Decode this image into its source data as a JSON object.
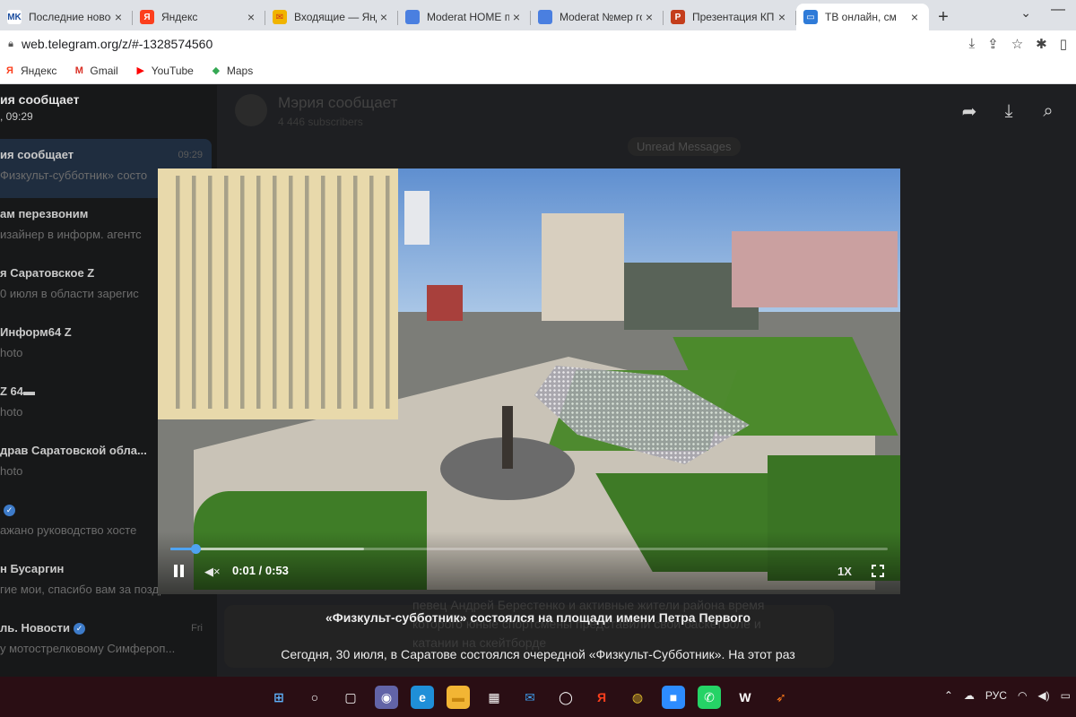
{
  "browser": {
    "tabs": [
      {
        "label": "Последние новос",
        "icon": "MK",
        "color": "#ffffff",
        "fg": "#1d4fa0",
        "active": false
      },
      {
        "label": "Яндекс",
        "icon": "Я",
        "color": "#fc3f1d",
        "fg": "#ffffff",
        "active": false
      },
      {
        "label": "Входящие — Янд",
        "icon": "✉",
        "color": "#f0b400",
        "fg": "#d12e1c",
        "active": false
      },
      {
        "label": "Moderat HOME пр",
        "icon": "",
        "color": "#4a7fe0",
        "fg": "#ffffff",
        "active": false
      },
      {
        "label": "Moderat №мер го",
        "icon": "",
        "color": "#4a7fe0",
        "fg": "#ffffff",
        "active": false
      },
      {
        "label": "Презентация КП.р",
        "icon": "P",
        "color": "#c43e1c",
        "fg": "#ffffff",
        "active": false
      },
      {
        "label": "ТВ онлайн, см",
        "icon": "▭",
        "color": "#2f7bd8",
        "fg": "#ffffff",
        "active": true
      }
    ],
    "new_tab": "+",
    "url": "web.telegram.org/z/#-1328574560",
    "bookmarks": [
      {
        "label": "Яндекс",
        "icon": "Я",
        "color": "#fc3f1d"
      },
      {
        "label": "Gmail",
        "icon": "M",
        "color": "#d93025"
      },
      {
        "label": "YouTube",
        "icon": "▶",
        "color": "#ff0000"
      },
      {
        "label": "Maps",
        "icon": "◆",
        "color": "#34a853"
      }
    ]
  },
  "telegram": {
    "sidebar_header": {
      "title": "ия сообщает",
      "subtitle": ", 09:29"
    },
    "chats": [
      {
        "name": "ия сообщает",
        "preview": "Физкульт-субботник» состо",
        "time": "09:29",
        "selected": true,
        "verified": false
      },
      {
        "name": "ам перезвоним",
        "preview": "изайнер в информ. агентс",
        "time": "",
        "selected": false,
        "verified": false
      },
      {
        "name": "я Саратовское Z",
        "preview": "0 июля в области зарегис",
        "time": "",
        "selected": false,
        "verified": false
      },
      {
        "name": "Информ64 Z",
        "preview": "hoto",
        "time": "",
        "selected": false,
        "verified": false
      },
      {
        "name": "Z 64▬",
        "preview": "hoto",
        "time": "",
        "selected": false,
        "verified": false
      },
      {
        "name": "драв Саратовской обла...",
        "preview": "hoto",
        "time": "",
        "selected": false,
        "verified": false
      },
      {
        "name": "",
        "preview": "ажано руководство хосте",
        "time": "",
        "selected": false,
        "verified": true
      },
      {
        "name": "н Бусаргин",
        "preview": "гие мои, спасибо вам за поздр...",
        "time": "",
        "selected": false,
        "verified": false
      },
      {
        "name": "ль. Новости",
        "preview": "у мотострелковому Симфероп...",
        "time": "Fri",
        "selected": false,
        "verified": true
      }
    ],
    "channel_title": "Мэрия сообщает",
    "channel_subscribers": "4 446 subscribers",
    "unread_label": "Unread Messages",
    "message_text": "певец Андрей Берестенко и активные жители района время которого юные спортсмены представили свои баскетболе и катании на скейтборде"
  },
  "player": {
    "progress_fraction": 0.035,
    "buffered_fraction": 0.27,
    "time": "0:01 / 0:53",
    "speed": "1X",
    "caption_title": "«Физкульт-субботник» состоялся на площади имени Петра Первого",
    "caption_text": "Сегодня, 30 июля, в Саратове состоялся очередной «Физкульт-Субботник». На этот раз"
  },
  "taskbar": {
    "icons": [
      {
        "name": "windows-start-icon",
        "glyph": "⊞",
        "color": "transparent",
        "fg": "#5fb4ff"
      },
      {
        "name": "search-icon",
        "glyph": "○",
        "color": "transparent",
        "fg": "#ffffff"
      },
      {
        "name": "task-view-icon",
        "glyph": "▢",
        "color": "transparent",
        "fg": "#ffffff"
      },
      {
        "name": "teams-chat-icon",
        "glyph": "◉",
        "color": "#6264a7",
        "fg": "#ffffff"
      },
      {
        "name": "edge-icon",
        "glyph": "e",
        "color": "#1f8fd8",
        "fg": "#ffffff"
      },
      {
        "name": "file-explorer-icon",
        "glyph": "▬",
        "color": "#f2b534",
        "fg": "#c8870f"
      },
      {
        "name": "store-icon",
        "glyph": "▦",
        "color": "transparent",
        "fg": "#ffffff"
      },
      {
        "name": "mail-icon",
        "glyph": "✉",
        "color": "transparent",
        "fg": "#3d9be9"
      },
      {
        "name": "app-circle-icon",
        "glyph": "◯",
        "color": "transparent",
        "fg": "#ffffff"
      },
      {
        "name": "yandex-icon",
        "glyph": "Я",
        "color": "transparent",
        "fg": "#fc3f1d"
      },
      {
        "name": "chrome-icon",
        "glyph": "◍",
        "color": "transparent",
        "fg": "#e2c02c"
      },
      {
        "name": "zoom-icon",
        "glyph": "■",
        "color": "#2d8cff",
        "fg": "#ffffff"
      },
      {
        "name": "whatsapp-icon",
        "glyph": "✆",
        "color": "#25d366",
        "fg": "#ffffff"
      },
      {
        "name": "app-w-icon",
        "glyph": "W",
        "color": "transparent",
        "fg": "#ffffff"
      },
      {
        "name": "app-rocket-icon",
        "glyph": "➶",
        "color": "transparent",
        "fg": "#ff7a1a"
      }
    ],
    "language": "РУС"
  }
}
